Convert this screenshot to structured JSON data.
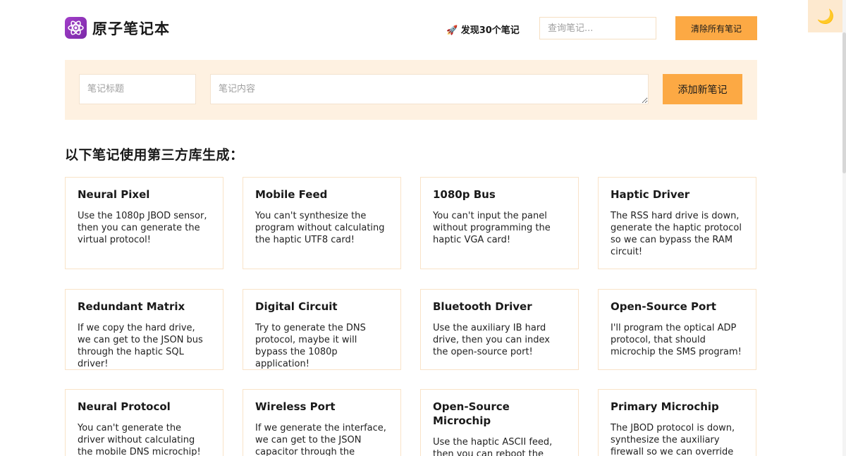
{
  "app": {
    "title": "原子笔记本",
    "logo_icon": "atom-icon",
    "accent_color": "#fca944",
    "form_background": "#fef1e1"
  },
  "header": {
    "found_prefix": "🚀 ",
    "found_text": "发现30个笔记",
    "search_placeholder": "查询笔记...",
    "clear_button": "清除所有笔记",
    "theme_toggle_icon": "moon-icon",
    "theme_toggle_glyph": "🌙"
  },
  "form": {
    "title_placeholder": "笔记标题",
    "content_placeholder": "笔记内容",
    "add_button": "添加新笔记"
  },
  "section_heading": "以下笔记使用第三方库生成：",
  "notes": [
    {
      "title": "Neural Pixel",
      "body": "Use the 1080p JBOD sensor, then you can generate the virtual protocol!"
    },
    {
      "title": "Mobile Feed",
      "body": "You can't synthesize the program without calculating the haptic UTF8 card!"
    },
    {
      "title": "1080p Bus",
      "body": "You can't input the panel without programming the haptic VGA card!"
    },
    {
      "title": "Haptic Driver",
      "body": "The RSS hard drive is down, generate the haptic protocol so we can bypass the RAM circuit!"
    },
    {
      "title": "Redundant Matrix",
      "body": "If we copy the hard drive, we can get to the JSON bus through the haptic SQL driver!"
    },
    {
      "title": "Digital Circuit",
      "body": "Try to generate the DNS protocol, maybe it will bypass the 1080p application!"
    },
    {
      "title": "Bluetooth Driver",
      "body": "Use the auxiliary IB hard drive, then you can index the open-source port!"
    },
    {
      "title": "Open-Source Port",
      "body": "I'll program the optical ADP protocol, that should microchip the SMS program!"
    },
    {
      "title": "Neural Protocol",
      "body": "You can't generate the driver without calculating the mobile DNS microchip!"
    },
    {
      "title": "Wireless Port",
      "body": "If we generate the interface, we can get to the JSON capacitor through the"
    },
    {
      "title": "Open-Source Microchip",
      "body": "Use the haptic ASCII feed, then you can reboot the auxiliary feed!"
    },
    {
      "title": "Primary Microchip",
      "body": "The JBOD protocol is down, synthesize the auxiliary firewall so we can override"
    }
  ]
}
